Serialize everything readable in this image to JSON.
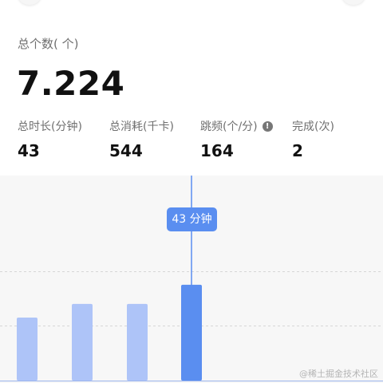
{
  "summary": {
    "caption": "总个数( 个)",
    "value": "7.224"
  },
  "stats": [
    {
      "label": "总时长(分钟)",
      "value": "43"
    },
    {
      "label": "总消耗(千卡)",
      "value": "544"
    },
    {
      "label": "跳频(个/分)",
      "value": "164",
      "info_icon": "info-icon"
    },
    {
      "label": "完成(次)",
      "value": "2"
    }
  ],
  "tooltip": {
    "text": "43 分钟"
  },
  "watermark": "@稀土掘金技术社区",
  "colors": {
    "bar": "#aec4f8",
    "bar_selected": "#5a8ef0",
    "tooltip": "#5a8ef0"
  },
  "chart_data": {
    "type": "bar",
    "title": "",
    "xlabel": "",
    "ylabel": "",
    "series": [
      {
        "values": [
          23,
          28,
          28,
          35
        ]
      }
    ],
    "ylim": [
      0,
      60
    ],
    "selected_index": 3,
    "grid": true
  }
}
